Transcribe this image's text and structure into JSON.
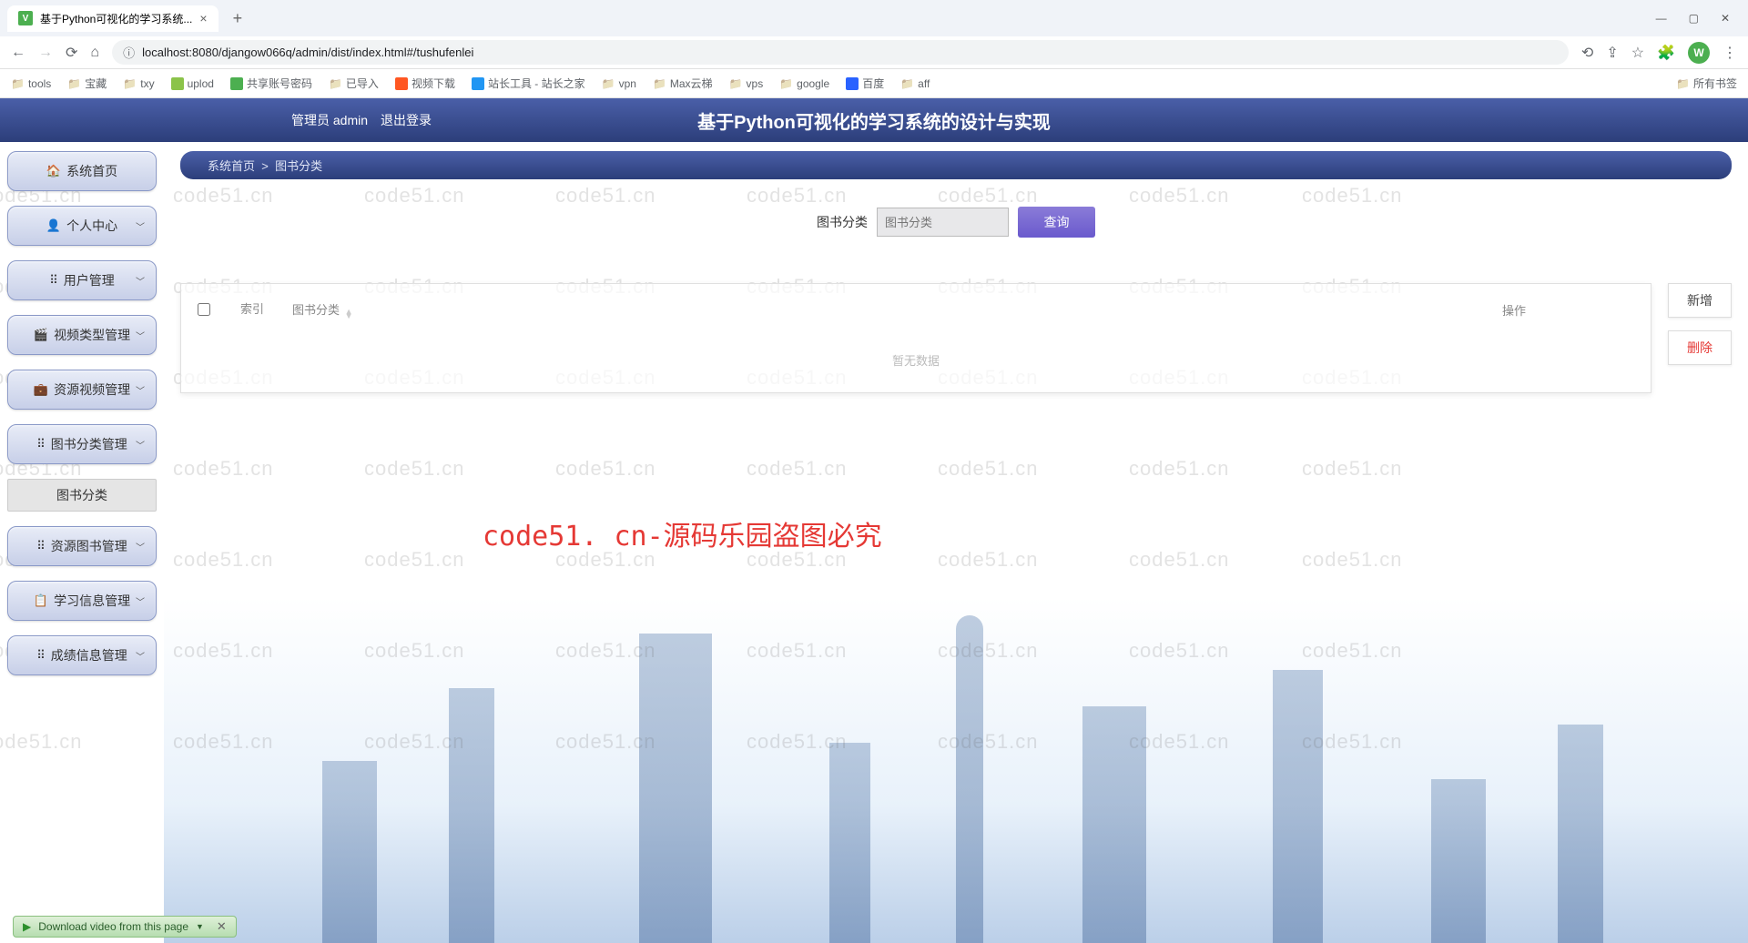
{
  "browser": {
    "tab_title": "基于Python可视化的学习系统...",
    "url": "localhost:8080/djangow066q/admin/dist/index.html#/tushufenlei",
    "avatar_letter": "W",
    "bookmarks": [
      "tools",
      "宝藏",
      "txy",
      "uplod",
      "共享账号密码",
      "已导入",
      "视频下载",
      "站长工具 - 站长之家",
      "vpn",
      "Max云梯",
      "vps",
      "google",
      "百度",
      "aff"
    ],
    "all_bookmarks": "所有书签"
  },
  "header": {
    "admin_label": "管理员 admin",
    "logout": "退出登录",
    "title": "基于Python可视化的学习系统的设计与实现"
  },
  "sidebar": {
    "items": [
      {
        "icon": "🏠",
        "label": "系统首页",
        "expand": false
      },
      {
        "icon": "👤",
        "label": "个人中心",
        "expand": true
      },
      {
        "icon": "⠿",
        "label": "用户管理",
        "expand": true
      },
      {
        "icon": "🎬",
        "label": "视频类型管理",
        "expand": true
      },
      {
        "icon": "💼",
        "label": "资源视频管理",
        "expand": true
      },
      {
        "icon": "⠿",
        "label": "图书分类管理",
        "expand": true
      },
      {
        "icon": "",
        "label": "图书分类",
        "expand": false,
        "sub": true
      },
      {
        "icon": "⠿",
        "label": "资源图书管理",
        "expand": true
      },
      {
        "icon": "📋",
        "label": "学习信息管理",
        "expand": true
      },
      {
        "icon": "⠿",
        "label": "成绩信息管理",
        "expand": true
      }
    ]
  },
  "breadcrumb": {
    "home": "系统首页",
    "sep": ">",
    "current": "图书分类"
  },
  "search": {
    "label": "图书分类",
    "placeholder": "图书分类",
    "button": "查询"
  },
  "table": {
    "col_index": "索引",
    "col_category": "图书分类",
    "col_op": "操作",
    "empty": "暂无数据"
  },
  "actions": {
    "add": "新增",
    "delete": "删除"
  },
  "watermark_text": "code51.cn",
  "watermark_red": "code51. cn-源码乐园盗图必究",
  "download_bar": "Download video from this page"
}
